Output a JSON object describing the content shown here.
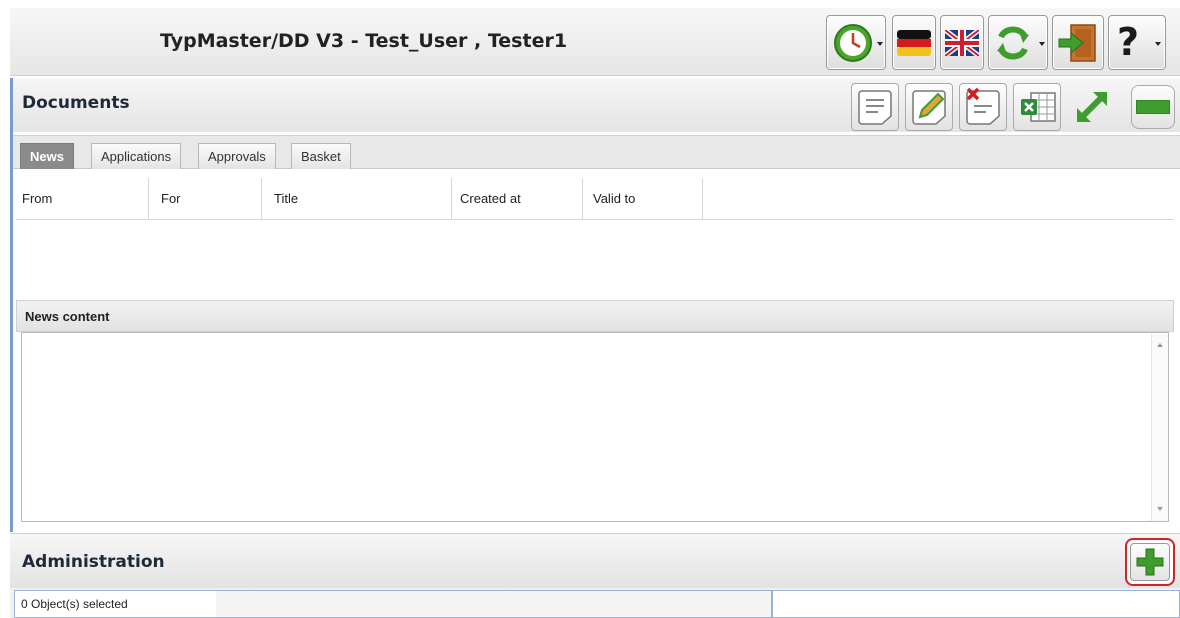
{
  "window": {
    "title": "TypMaster/DD V3 - Test_User , Tester1"
  },
  "toolbar": {
    "buttons": [
      {
        "icon": "clock-icon",
        "has_dropdown": true
      },
      {
        "icon": "german-flag-icon",
        "has_dropdown": false
      },
      {
        "icon": "uk-flag-icon",
        "has_dropdown": false
      },
      {
        "icon": "refresh-icon",
        "has_dropdown": true
      },
      {
        "icon": "exit-door-icon",
        "has_dropdown": false
      },
      {
        "icon": "help-icon",
        "has_dropdown": true
      }
    ]
  },
  "documents": {
    "title": "Documents",
    "actions": [
      "document-icon",
      "edit-document-icon",
      "delete-document-icon",
      "excel-export-icon",
      "expand-icon",
      "collapse-icon"
    ],
    "tabs": [
      {
        "label": "News",
        "active": true
      },
      {
        "label": "Applications",
        "active": false
      },
      {
        "label": "Approvals",
        "active": false
      },
      {
        "label": "Basket",
        "active": false
      }
    ],
    "columns": [
      "From",
      "For",
      "Title",
      "Created at",
      "Valid to"
    ],
    "rows": [],
    "news_content_label": "News content"
  },
  "administration": {
    "title": "Administration",
    "add_icon": "add-icon"
  },
  "status": {
    "selection": "0 Object(s) selected"
  },
  "colors": {
    "panel_border": "#7a9cc7",
    "highlight_border": "#d0242a",
    "green": "#3f9d2e"
  }
}
